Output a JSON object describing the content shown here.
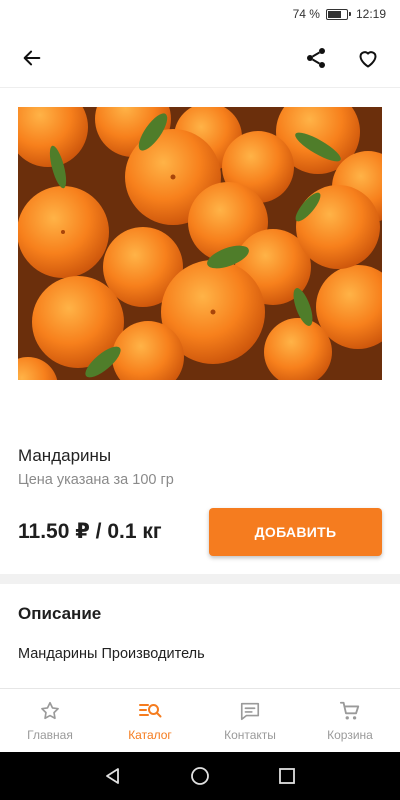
{
  "status_bar": {
    "battery_percent_label": "74 %",
    "battery_level": 0.74,
    "time": "12:19"
  },
  "top_bar": {
    "back_icon": "arrow-left-icon",
    "share_icon": "share-icon",
    "favorite_icon": "heart-outline-icon"
  },
  "product": {
    "image": "tangerines-photo",
    "name": "Мандарины",
    "price_note": "Цена указана за 100 гр",
    "price": "11.50 ₽ / 0.1 кг",
    "add_button_label": "ДОБАВИТЬ"
  },
  "description": {
    "title": "Описание",
    "text": "Мандарины Производитель"
  },
  "bottom_nav": {
    "items": [
      {
        "label": "Главная",
        "icon": "star-outline-icon"
      },
      {
        "label": "Каталог",
        "icon": "catalog-search-icon"
      },
      {
        "label": "Контакты",
        "icon": "chat-icon"
      },
      {
        "label": "Корзина",
        "icon": "cart-icon"
      }
    ],
    "active_index": 1
  },
  "colors": {
    "accent": "#f57c1f",
    "inactive": "#9a9a9a",
    "text": "#222222",
    "secondary_text": "#8a8a8a"
  }
}
